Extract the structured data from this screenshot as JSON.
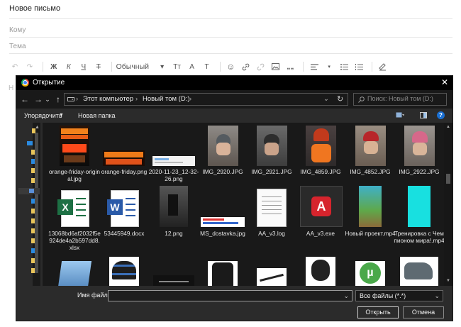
{
  "compose": {
    "title": "Новое письмо",
    "to_label": "Кому",
    "subject_label": "Тема",
    "body_hint": "Н",
    "toolbar": {
      "undo": "↶",
      "redo": "↷",
      "bold": "Ж",
      "italic": "К",
      "underline": "Ч",
      "strike": "Т",
      "style_select": "Обычный",
      "font_size": "Тт",
      "text_color": "A",
      "bg_color": "T",
      "emoji": "☺",
      "quote": "„„"
    }
  },
  "dialog": {
    "title": "Открытие",
    "close": "✕",
    "nav": {
      "back": "←",
      "forward": "→",
      "recent": "⌄",
      "up": "↑",
      "refresh": "↻"
    },
    "breadcrumb": [
      "Этот компьютер",
      "Новый том (D:)"
    ],
    "search_placeholder": "Поиск: Новый том (D:)",
    "commands": {
      "organize": "Упорядочить",
      "new_folder": "Новая папка"
    },
    "files": [
      {
        "name": "orange-friday-original.jpg",
        "kind": "poster"
      },
      {
        "name": "orange-friday.png",
        "kind": "banner"
      },
      {
        "name": "2020-11-23_12-32-26.png",
        "kind": "screenshot"
      },
      {
        "name": "IMG_2920.JPG",
        "kind": "hat-grey"
      },
      {
        "name": "IMG_2921.JPG",
        "kind": "hat-dark"
      },
      {
        "name": "IMG_4859.JPG",
        "kind": "hat-orange"
      },
      {
        "name": "IMG_4852.JPG",
        "kind": "hat-red"
      },
      {
        "name": "IMG_2922.JPG",
        "kind": "hat-pink"
      },
      {
        "name": "13068bd6af2032f5e924de4a2b597dd8.xlsx",
        "kind": "excel"
      },
      {
        "name": "53445949.docx",
        "kind": "word"
      },
      {
        "name": "12.png",
        "kind": "photo-dark"
      },
      {
        "name": "MS_dostavka.jpg",
        "kind": "delivery"
      },
      {
        "name": "AA_v3.log",
        "kind": "textfile"
      },
      {
        "name": "AA_v3.exe",
        "kind": "anyapp"
      },
      {
        "name": "Новый проект.mp4",
        "kind": "video-green"
      },
      {
        "name": "Тренировка с Чемпионом мира!.mp4",
        "kind": "video-cyan"
      },
      {
        "name": "",
        "kind": "notepad"
      },
      {
        "name": "",
        "kind": "beanie"
      },
      {
        "name": "",
        "kind": "black-card"
      },
      {
        "name": "",
        "kind": "jacket"
      },
      {
        "name": "",
        "kind": "pen"
      },
      {
        "name": "",
        "kind": "helmet"
      },
      {
        "name": "",
        "kind": "utorrent"
      },
      {
        "name": "",
        "kind": "boot"
      }
    ],
    "filename_label": "Имя файла:",
    "filename_value": "",
    "filetype_value": "Все файлы (*.*)",
    "open_button": "Открыть",
    "cancel_button": "Отмена"
  }
}
